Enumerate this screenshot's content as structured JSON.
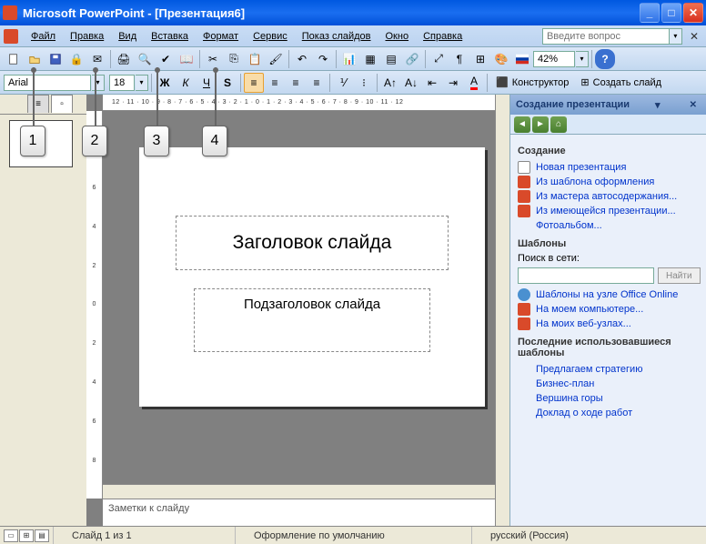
{
  "title": "Microsoft PowerPoint - [Презентация6]",
  "askbox_placeholder": "Введите вопрос",
  "menus": {
    "file": "Файл",
    "edit": "Правка",
    "view": "Вид",
    "insert": "Вставка",
    "format": "Формат",
    "tools": "Сервис",
    "slideshow": "Показ слайдов",
    "window": "Окно",
    "help": "Справка"
  },
  "font": {
    "name": "Arial",
    "size": "18"
  },
  "zoom": "42%",
  "designer_btn": "Конструктор",
  "newslide_btn": "Создать слайд",
  "slide": {
    "title": "Заголовок слайда",
    "subtitle": "Подзаголовок слайда"
  },
  "notes_placeholder": "Заметки к слайду",
  "thumb_num": "1",
  "taskpane": {
    "title": "Создание презентации",
    "sec_create": "Создание",
    "link_new": "Новая презентация",
    "link_template": "Из шаблона оформления",
    "link_wizard": "Из мастера автосодержания...",
    "link_existing": "Из имеющейся презентации...",
    "link_album": "Фотоальбом...",
    "sec_templates": "Шаблоны",
    "search_label": "Поиск в сети:",
    "search_btn": "Найти",
    "link_online": "Шаблоны на узле Office Online",
    "link_mycomp": "На моем компьютере...",
    "link_mysites": "На моих веб-узлах...",
    "sec_recent": "Последние использовавшиеся шаблоны",
    "recent1": "Предлагаем стратегию",
    "recent2": "Бизнес-план",
    "recent3": "Вершина горы",
    "recent4": "Доклад о ходе работ"
  },
  "status": {
    "slide": "Слайд 1 из 1",
    "design": "Оформление по умолчанию",
    "lang": "русский (Россия)"
  },
  "callouts": {
    "c1": "1",
    "c2": "2",
    "c3": "3",
    "c4": "4"
  },
  "ruler_h": "12 · 11 · 10 · 9 · 8 · 7 · 6 · 5 · 4 · 3 · 2 · 1 · 0 · 1 · 2 · 3 · 4 · 5 · 6 · 7 · 8 · 9 · 10 · 11 · 12"
}
